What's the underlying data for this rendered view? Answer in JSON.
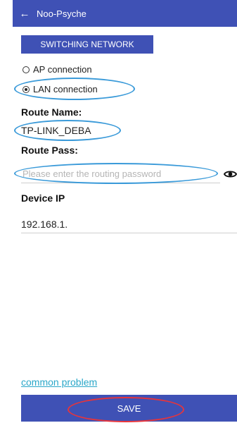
{
  "appbar": {
    "back_icon": "arrow-left-icon",
    "title": "Noo-Psyche"
  },
  "switch_network": {
    "label": "SWITCHING NETWORK"
  },
  "connection": {
    "options": [
      {
        "label": "AP connection",
        "selected": false
      },
      {
        "label": "LAN connection",
        "selected": true
      }
    ]
  },
  "route_name": {
    "label": "Route Name:",
    "value": "TP-LINK_DEBA"
  },
  "route_pass": {
    "label": "Route Pass:",
    "placeholder": "Please enter the routing password",
    "visibility_icon": "eye-icon"
  },
  "device_ip": {
    "label": "Device IP",
    "value": "192.168.1."
  },
  "footer": {
    "link": "common problem",
    "save_label": "SAVE"
  },
  "colors": {
    "primary": "#3f51b5",
    "highlight_blue": "#3a9ad9",
    "highlight_red": "#e8343a",
    "link": "#2aa7c9"
  }
}
